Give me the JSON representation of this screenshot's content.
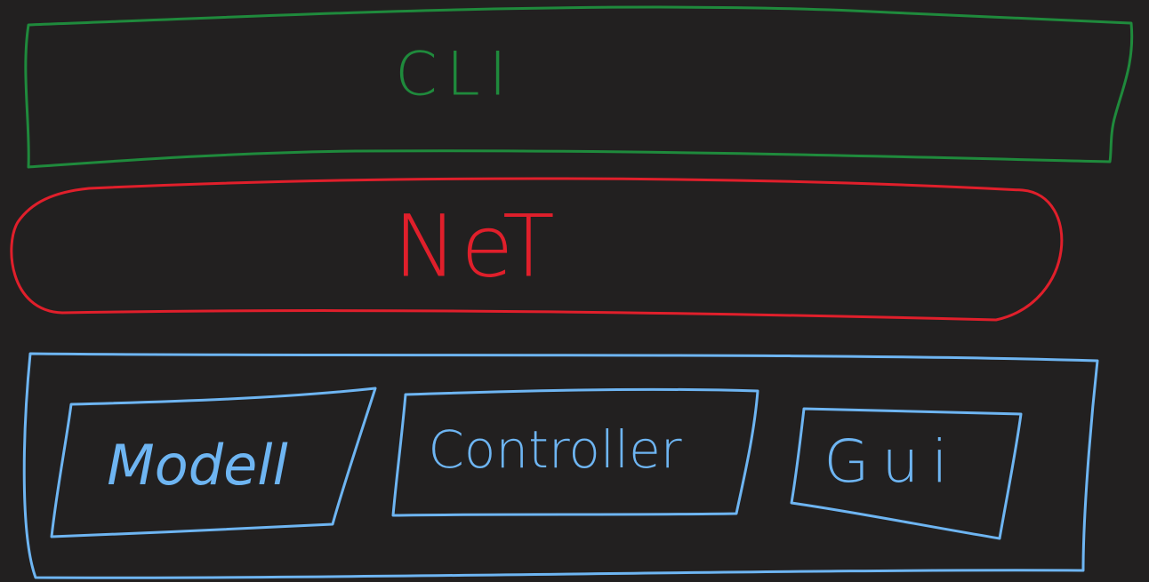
{
  "colors": {
    "background": "#222020",
    "cli": "#1f8a3c",
    "net": "#e01f2b",
    "ui_layer": "#6eb5f2"
  },
  "layers": {
    "cli": {
      "label": "CLI"
    },
    "net": {
      "label": "NeT"
    },
    "ui": {
      "components": {
        "model": {
          "label": "Modell"
        },
        "controller": {
          "label": "Controller"
        },
        "gui": {
          "label": "Gui"
        }
      }
    }
  }
}
